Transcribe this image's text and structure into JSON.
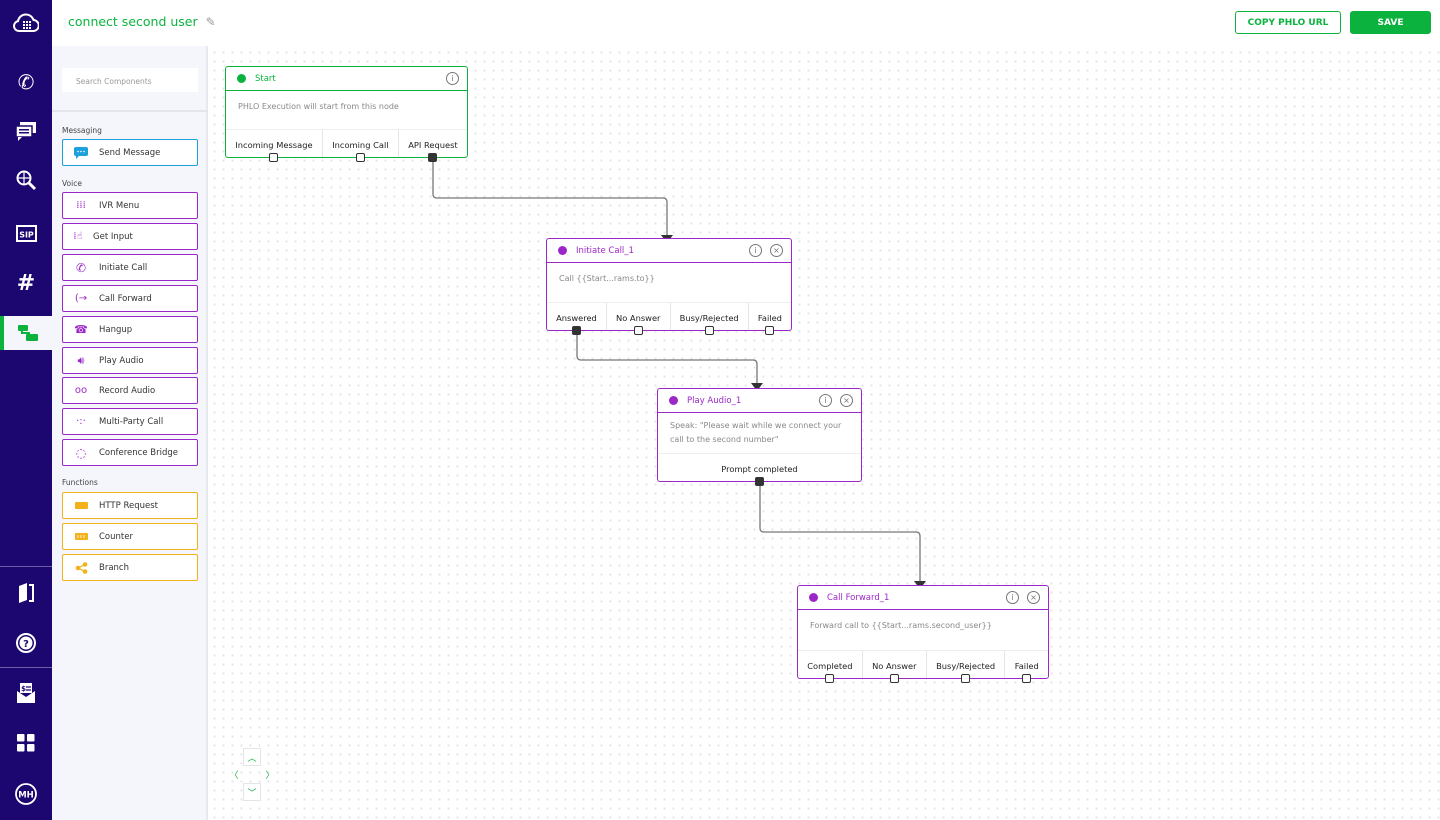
{
  "app": {
    "title": "connect second user",
    "edit_icon": "pencil-icon"
  },
  "toolbar": {
    "copy_label": "COPY PHLO URL",
    "save_label": "SAVE"
  },
  "rail": {
    "items": [
      {
        "name": "logo",
        "icon": "cloud-grid-icon"
      },
      {
        "name": "voice",
        "icon": "phone-signal-icon"
      },
      {
        "name": "messaging",
        "icon": "chat-icon"
      },
      {
        "name": "lookup",
        "icon": "globe-search-icon"
      },
      {
        "name": "sip",
        "icon": "sip-icon"
      },
      {
        "name": "numbers",
        "icon": "hash-icon"
      },
      {
        "name": "phlo",
        "icon": "flow-icon",
        "active": true
      },
      {
        "name": "docs",
        "icon": "book-icon"
      },
      {
        "name": "help",
        "icon": "help-icon"
      },
      {
        "name": "billing",
        "icon": "billing-icon"
      },
      {
        "name": "apps",
        "icon": "grid-icon"
      },
      {
        "name": "account",
        "icon": "avatar-icon",
        "initials": "MH"
      }
    ]
  },
  "panel": {
    "search_placeholder": "Search Components",
    "sections": {
      "messaging": "Messaging",
      "voice": "Voice",
      "functions": "Functions"
    },
    "messaging": [
      {
        "label": "Send Message",
        "icon": "chat-bubble-icon"
      }
    ],
    "voice": [
      {
        "label": "IVR Menu",
        "icon": "keypad-icon"
      },
      {
        "label": "Get Input",
        "icon": "keypad-hand-icon"
      },
      {
        "label": "Initiate Call",
        "icon": "phone-icon"
      },
      {
        "label": "Call Forward",
        "icon": "call-forward-icon"
      },
      {
        "label": "Hangup",
        "icon": "hangup-icon"
      },
      {
        "label": "Play Audio",
        "icon": "speaker-icon"
      },
      {
        "label": "Record Audio",
        "icon": "voicemail-icon"
      },
      {
        "label": "Multi-Party Call",
        "icon": "multiparty-icon"
      },
      {
        "label": "Conference Bridge",
        "icon": "conference-icon"
      }
    ],
    "functions": [
      {
        "label": "HTTP Request",
        "icon": "http-icon"
      },
      {
        "label": "Counter",
        "icon": "counter-icon"
      },
      {
        "label": "Branch",
        "icon": "branch-icon"
      }
    ]
  },
  "colors": {
    "green": "#0bb33e",
    "purple": "#9c27c8",
    "blue": "#1da1dc",
    "orange": "#f3b21c",
    "rail": "#1c0770"
  },
  "nodes": {
    "start": {
      "title": "Start",
      "body": "PHLO Execution will start from this node",
      "outputs": [
        "Incoming Message",
        "Incoming Call",
        "API Request"
      ]
    },
    "initiate": {
      "title": "Initiate Call_1",
      "body": "Call {{Start...rams.to}}",
      "outputs": [
        "Answered",
        "No Answer",
        "Busy/Rejected",
        "Failed"
      ]
    },
    "play": {
      "title": "Play Audio_1",
      "body": "Speak: \"Please wait while we connect your call to the second number\"",
      "outputs": [
        "Prompt completed"
      ]
    },
    "forward": {
      "title": "Call Forward_1",
      "body": "Forward call to {{Start...rams.second_user}}",
      "outputs": [
        "Completed",
        "No Answer",
        "Busy/Rejected",
        "Failed"
      ]
    }
  },
  "connections": [
    {
      "from": "start.API Request",
      "to": "initiate"
    },
    {
      "from": "initiate.Answered",
      "to": "play"
    },
    {
      "from": "play.Prompt completed",
      "to": "forward"
    }
  ],
  "nav": {
    "up": "^",
    "down": "v",
    "left": "<",
    "right": ">"
  }
}
